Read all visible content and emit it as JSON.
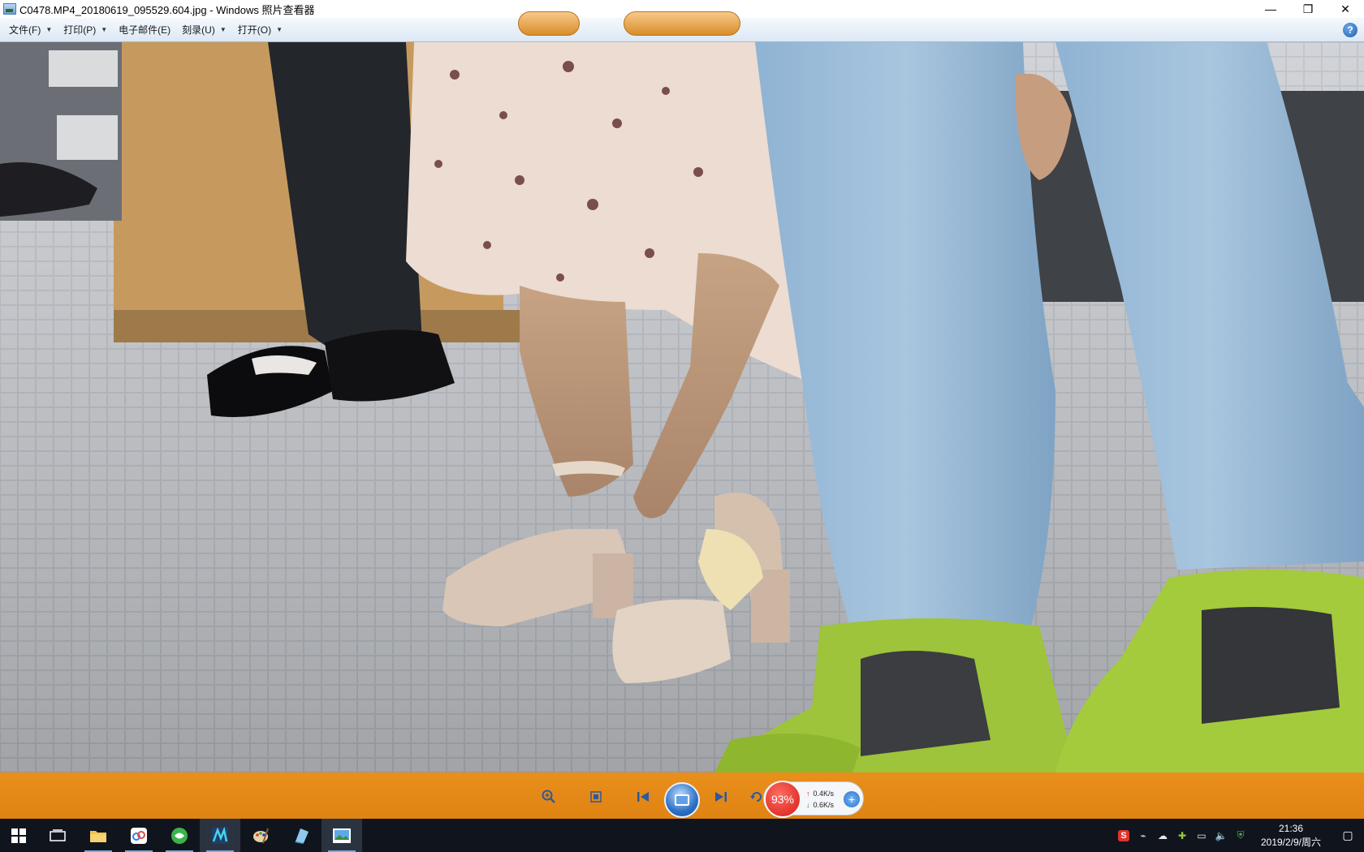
{
  "window": {
    "title": "C0478.MP4_20180619_095529.604.jpg - Windows 照片查看器",
    "minimize": "—",
    "restore": "❐",
    "close": "✕"
  },
  "menu": {
    "items": [
      {
        "label": "文件(F)",
        "has_caret": true
      },
      {
        "label": "打印(P)",
        "has_caret": true
      },
      {
        "label": "电子邮件(E)",
        "has_caret": false
      },
      {
        "label": "刻录(U)",
        "has_caret": true
      },
      {
        "label": "打开(O)",
        "has_caret": true
      }
    ],
    "help": "?"
  },
  "toolbar": {
    "zoom_icon": "zoom-icon",
    "fit_icon": "actual-size-icon",
    "prev_icon": "previous-icon",
    "slideshow_icon": "slideshow-icon",
    "next_icon": "next-icon",
    "rotate_icon": "rotate-icon"
  },
  "speed_widget": {
    "percent": "93%",
    "upload": "0.4K/s",
    "download": "0.6K/s"
  },
  "taskbar": {
    "apps": [
      "windows-start-icon",
      "task-view-icon",
      "file-explorer-icon",
      "baidu-netdisk-icon",
      "browser-icon",
      "video-editor-icon",
      "paint-icon",
      "notes-icon",
      "photo-viewer-icon"
    ],
    "clock_time": "21:36",
    "clock_date": "2019/2/9/周六",
    "ime_label": "S"
  },
  "colors": {
    "toolbar_orange": "#e98f1c",
    "taskbar": "#10151d",
    "speed_red": "#d51c14"
  }
}
